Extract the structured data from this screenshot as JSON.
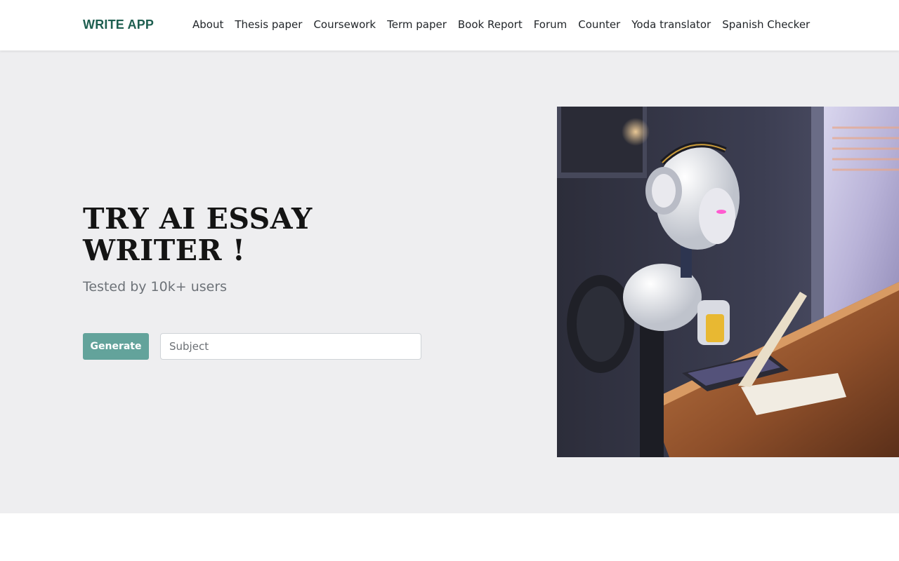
{
  "navbar": {
    "brand": "WRITE APP",
    "links": [
      {
        "label": "About"
      },
      {
        "label": "Thesis paper"
      },
      {
        "label": "Coursework"
      },
      {
        "label": "Term paper"
      },
      {
        "label": "Book Report"
      },
      {
        "label": "Forum"
      },
      {
        "label": "Counter"
      },
      {
        "label": "Yoda translator"
      },
      {
        "label": "Spanish Checker"
      }
    ]
  },
  "hero": {
    "title": "TRY AI ESSAY WRITER !",
    "subtitle": "Tested by 10k+ users",
    "generate_label": "Generate",
    "subject_placeholder": "Subject"
  },
  "colors": {
    "brand": "#1e5f50",
    "button": "#63a39b",
    "hero_background": "#eeeef0"
  }
}
